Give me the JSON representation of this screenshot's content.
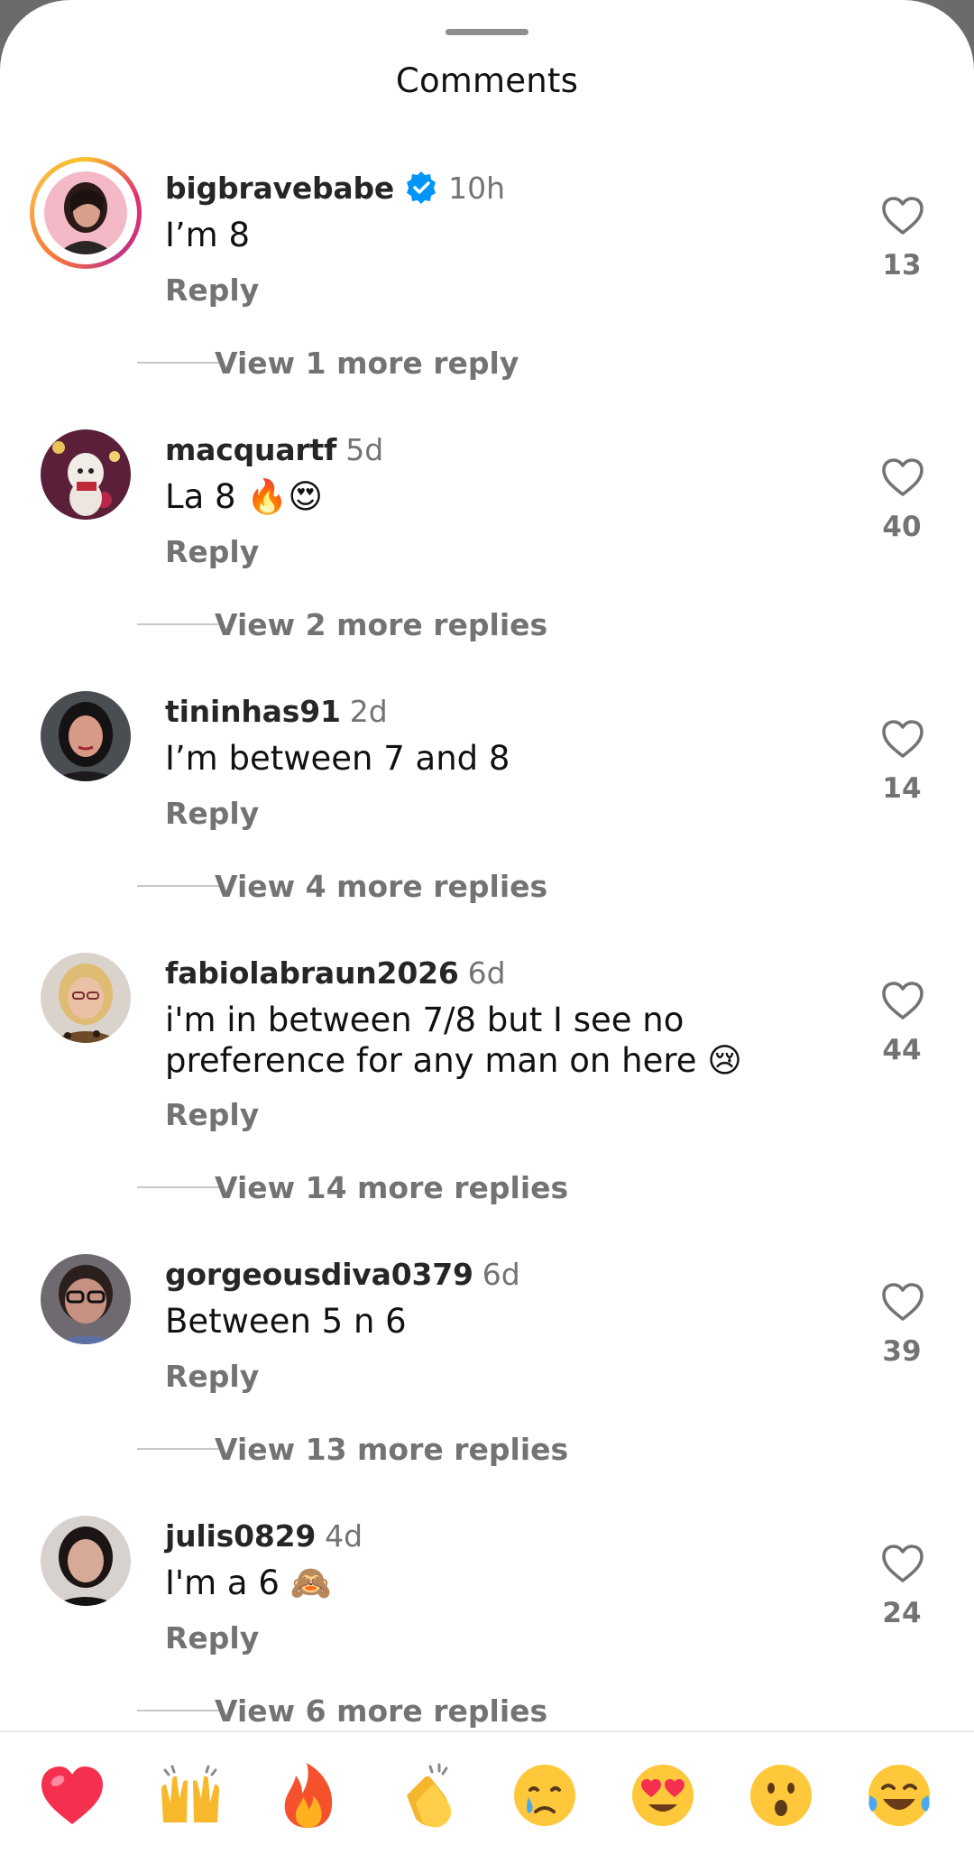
{
  "sheet": {
    "title": "Comments"
  },
  "comments": [
    {
      "username": "bigbravebabe",
      "verified": true,
      "time": "10h",
      "text": "I’m 8",
      "reply_label": "Reply",
      "likes": "13",
      "view_more": "View 1 more reply",
      "avatar_icon": "avatar-bigbravebabe",
      "story_ring": true
    },
    {
      "username": "macquartf",
      "verified": false,
      "time": "5d",
      "text": "La 8 🔥😍",
      "reply_label": "Reply",
      "likes": "40",
      "view_more": "View 2 more replies",
      "avatar_icon": "avatar-macquartf"
    },
    {
      "username": "tininhas91",
      "verified": false,
      "time": "2d",
      "text": "I’m between 7 and 8",
      "reply_label": "Reply",
      "likes": "14",
      "view_more": "View 4 more replies",
      "avatar_icon": "avatar-tininhas91"
    },
    {
      "username": "fabiolabraun2026",
      "verified": false,
      "time": "6d",
      "text": "i'm in between 7/8 but I see no preference for any man on here 😢",
      "reply_label": "Reply",
      "likes": "44",
      "view_more": "View 14 more replies",
      "avatar_icon": "avatar-fabiolabraun2026"
    },
    {
      "username": "gorgeousdiva0379",
      "verified": false,
      "time": "6d",
      "text": "Between 5 n 6",
      "reply_label": "Reply",
      "likes": "39",
      "view_more": "View 13 more replies",
      "avatar_icon": "avatar-gorgeousdiva0379"
    },
    {
      "username": "julis0829",
      "verified": false,
      "time": "4d",
      "text": "I'm a 6 🙈",
      "reply_label": "Reply",
      "likes": "24",
      "view_more": "View 6 more replies",
      "avatar_icon": "avatar-julis0829"
    }
  ],
  "reactions": [
    {
      "icon": "red-heart-emoji"
    },
    {
      "icon": "raising-hands-emoji"
    },
    {
      "icon": "fire-emoji"
    },
    {
      "icon": "clapping-hands-emoji"
    },
    {
      "icon": "crying-face-emoji"
    },
    {
      "icon": "heart-eyes-emoji"
    },
    {
      "icon": "surprised-face-emoji"
    },
    {
      "icon": "tears-of-joy-emoji"
    }
  ],
  "colors": {
    "verified": "#0095f6",
    "text": "#262626",
    "secondary": "#737373"
  }
}
